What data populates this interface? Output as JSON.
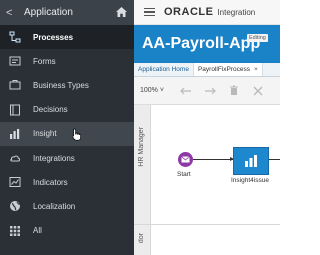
{
  "sidebar": {
    "back_label": "<",
    "title": "Application",
    "home_icon": "home-icon",
    "items": [
      {
        "label": "Processes",
        "icon": "processes-icon"
      },
      {
        "label": "Forms",
        "icon": "forms-icon"
      },
      {
        "label": "Business Types",
        "icon": "business-types-icon"
      },
      {
        "label": "Decisions",
        "icon": "decisions-icon"
      },
      {
        "label": "Insight",
        "icon": "insight-icon"
      },
      {
        "label": "Integrations",
        "icon": "integrations-icon"
      },
      {
        "label": "Indicators",
        "icon": "indicators-icon"
      },
      {
        "label": "Localization",
        "icon": "localization-icon"
      },
      {
        "label": "All",
        "icon": "grid-icon"
      }
    ]
  },
  "header": {
    "brand": "ORACLE",
    "product": "Integration"
  },
  "app_title": {
    "name": "AA-Payroll-App",
    "badge": "Editing"
  },
  "tabs": [
    {
      "label": "Application Home"
    },
    {
      "label": "PayrollFixProcess",
      "close": "×"
    }
  ],
  "toolbar": {
    "zoom": "100% ˅"
  },
  "canvas": {
    "lane_1": "HR Manager",
    "lane_2": "dor",
    "start_label": "Start",
    "activity_label": "Insight4issue"
  },
  "colors": {
    "sidebar_bg": "#2b3036",
    "title_bar": "#1a82c7",
    "start_node": "#8e3aa6",
    "activity": "#1e88cf"
  }
}
